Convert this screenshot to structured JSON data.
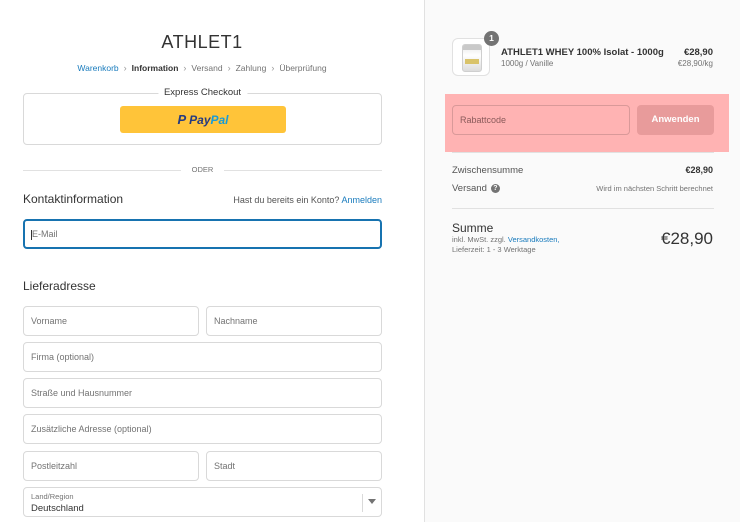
{
  "shop": {
    "title": "ATHLET1"
  },
  "breadcrumb": {
    "cart": "Warenkorb",
    "information": "Information",
    "shipping": "Versand",
    "payment": "Zahlung",
    "review": "Überprüfung"
  },
  "express": {
    "title": "Express Checkout",
    "paypal_part1": "Pay",
    "paypal_part2": "Pal"
  },
  "or_divider": "ODER",
  "contact": {
    "heading": "Kontaktinformation",
    "login_prompt": "Hast du bereits ein Konto?",
    "login_link": "Anmelden",
    "email_placeholder": "E-Mail"
  },
  "shipping_address": {
    "heading": "Lieferadresse",
    "first_name_placeholder": "Vorname",
    "last_name_placeholder": "Nachname",
    "company_placeholder": "Firma (optional)",
    "street_placeholder": "Straße und Hausnummer",
    "address2_placeholder": "Zusätzliche Adresse (optional)",
    "zip_placeholder": "Postleitzahl",
    "city_placeholder": "Stadt",
    "country_label": "Land/Region",
    "country_value": "Deutschland"
  },
  "order": {
    "product": {
      "quantity": "1",
      "name": "ATHLET1 WHEY 100% Isolat - 1000g",
      "variant": "1000g / Vanille",
      "price": "€28,90",
      "unit_price": "€28,90/kg"
    },
    "discount": {
      "placeholder": "Rabattcode",
      "apply_label": "Anwenden"
    },
    "subtotal_label": "Zwischensumme",
    "subtotal_value": "€28,90",
    "shipping_label": "Versand",
    "shipping_note": "Wird im nächsten Schritt berechnet",
    "total_label": "Summe",
    "tax_note": "inkl. MwSt. zzgl.",
    "shipping_cost_link": "Versandkosten,",
    "delivery_time": "Lieferzeit: 1 - 3 Werktage",
    "total_value": "€28,90"
  },
  "colors": {
    "link": "#197bbd",
    "paypal_yellow": "#ffc439",
    "highlight": "#ffb3b3"
  }
}
